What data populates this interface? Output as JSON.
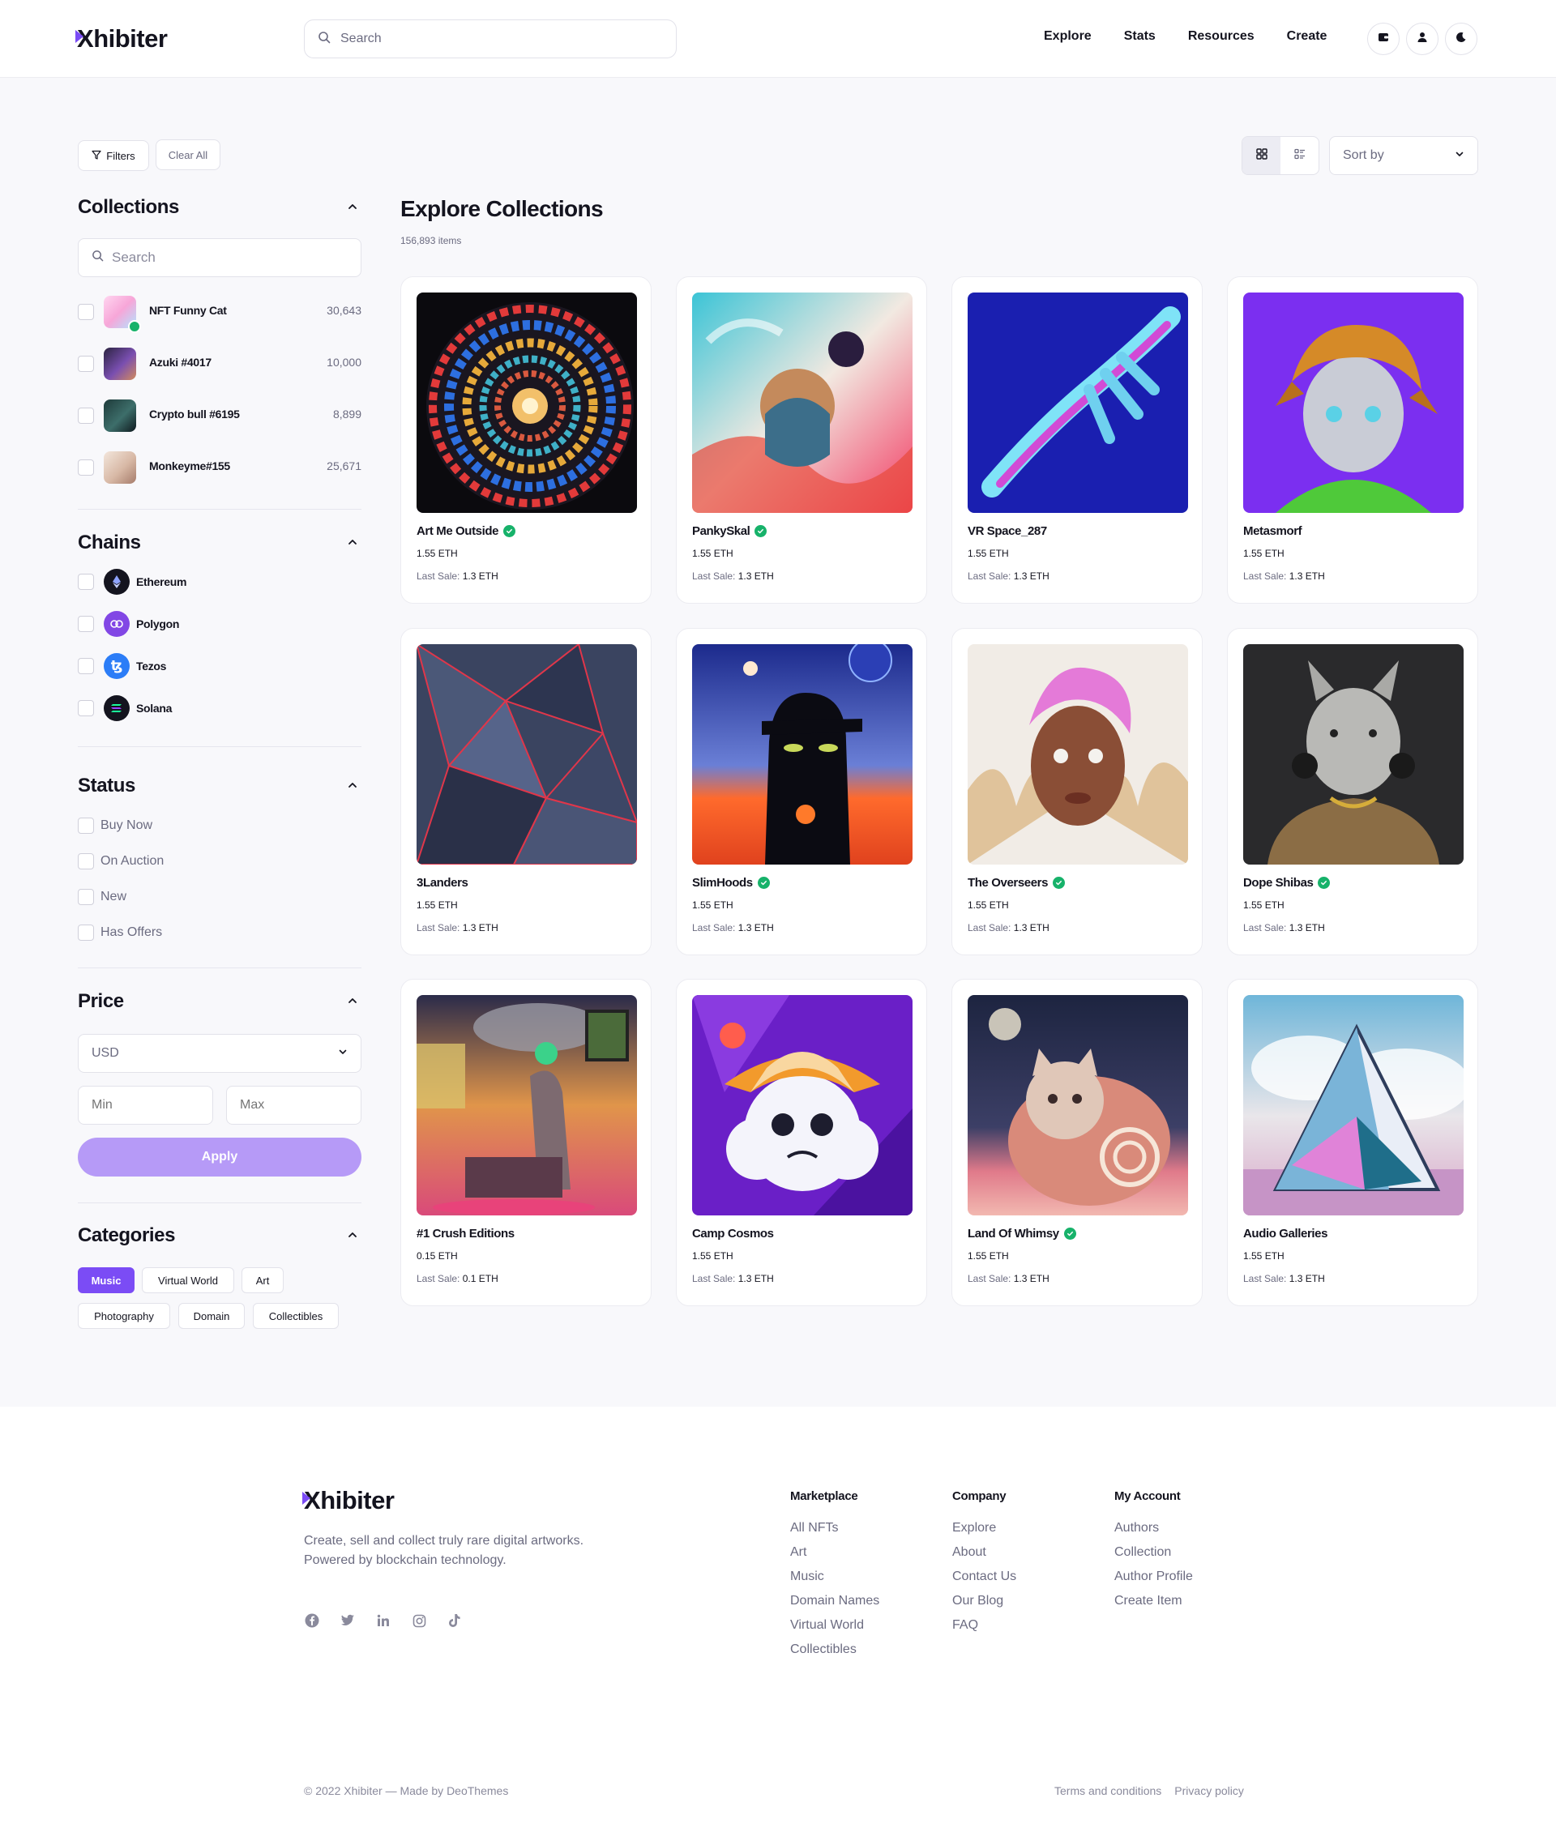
{
  "brand": {
    "mark": "X",
    "name": "hibiter",
    "accent": "#7b4cf5"
  },
  "header": {
    "search_placeholder": "Search",
    "nav": [
      "Explore",
      "Stats",
      "Resources",
      "Create"
    ],
    "icons": [
      "wallet-icon",
      "user-icon",
      "moon-icon"
    ]
  },
  "toolbar": {
    "filters_label": "Filters",
    "clear_label": "Clear All",
    "sort_label": "Sort by",
    "view_modes": [
      "grid-view-icon",
      "list-view-icon"
    ]
  },
  "sidebar": {
    "collections": {
      "title": "Collections",
      "search_placeholder": "Search",
      "items": [
        {
          "name": "NFT Funny Cat",
          "count": "30,643",
          "verified": true
        },
        {
          "name": "Azuki #4017",
          "count": "10,000",
          "verified": false
        },
        {
          "name": "Crypto bull #6195",
          "count": "8,899",
          "verified": false
        },
        {
          "name": "Monkeyme#155",
          "count": "25,671",
          "verified": false
        }
      ]
    },
    "chains": {
      "title": "Chains",
      "items": [
        "Ethereum",
        "Polygon",
        "Tezos",
        "Solana"
      ]
    },
    "status": {
      "title": "Status",
      "items": [
        "Buy Now",
        "On Auction",
        "New",
        "Has Offers"
      ]
    },
    "price": {
      "title": "Price",
      "currency": "USD",
      "min_placeholder": "Min",
      "max_placeholder": "Max",
      "apply_label": "Apply"
    },
    "categories": {
      "title": "Categories",
      "items": [
        "Music",
        "Virtual World",
        "Art",
        "Photography",
        "Domain",
        "Collectibles"
      ],
      "active": "Music"
    }
  },
  "main": {
    "title": "Explore Collections",
    "count": "156,893",
    "count_suffix": "items",
    "last_sale_label": "Last Sale:",
    "cards": [
      {
        "name": "Art Me Outside",
        "verified": true,
        "price": "1.55 ETH",
        "last_sale": "1.3 ETH"
      },
      {
        "name": "PankySkal",
        "verified": true,
        "price": "1.55 ETH",
        "last_sale": "1.3 ETH"
      },
      {
        "name": "VR Space_287",
        "verified": false,
        "price": "1.55 ETH",
        "last_sale": "1.3 ETH"
      },
      {
        "name": "Metasmorf",
        "verified": false,
        "price": "1.55 ETH",
        "last_sale": "1.3 ETH"
      },
      {
        "name": "3Landers",
        "verified": false,
        "price": "1.55 ETH",
        "last_sale": "1.3 ETH"
      },
      {
        "name": "SlimHoods",
        "verified": true,
        "price": "1.55 ETH",
        "last_sale": "1.3 ETH"
      },
      {
        "name": "The Overseers",
        "verified": true,
        "price": "1.55 ETH",
        "last_sale": "1.3 ETH"
      },
      {
        "name": "Dope Shibas",
        "verified": true,
        "price": "1.55 ETH",
        "last_sale": "1.3 ETH"
      },
      {
        "name": "#1 Crush Editions",
        "verified": false,
        "price": "0.15 ETH",
        "last_sale": "0.1 ETH"
      },
      {
        "name": "Camp Cosmos",
        "verified": false,
        "price": "1.55 ETH",
        "last_sale": "1.3 ETH"
      },
      {
        "name": "Land Of Whimsy",
        "verified": true,
        "price": "1.55 ETH",
        "last_sale": "1.3 ETH"
      },
      {
        "name": "Audio Galleries",
        "verified": false,
        "price": "1.55 ETH",
        "last_sale": "1.3 ETH"
      }
    ]
  },
  "footer": {
    "description": "Create, sell and collect truly rare digital artworks. Powered by blockchain technology.",
    "socials": [
      "facebook-icon",
      "twitter-icon",
      "linkedin-icon",
      "instagram-icon",
      "tiktok-icon"
    ],
    "columns": [
      {
        "title": "Marketplace",
        "links": [
          "All NFTs",
          "Art",
          "Music",
          "Domain Names",
          "Virtual World",
          "Collectibles"
        ]
      },
      {
        "title": "Company",
        "links": [
          "Explore",
          "About",
          "Contact Us",
          "Our Blog",
          "FAQ"
        ]
      },
      {
        "title": "My Account",
        "links": [
          "Authors",
          "Collection",
          "Author Profile",
          "Create Item"
        ]
      }
    ],
    "copyright": "© 2022 Xhibiter — Made by DeoThemes",
    "legal": [
      "Terms and conditions",
      "Privacy policy"
    ]
  }
}
